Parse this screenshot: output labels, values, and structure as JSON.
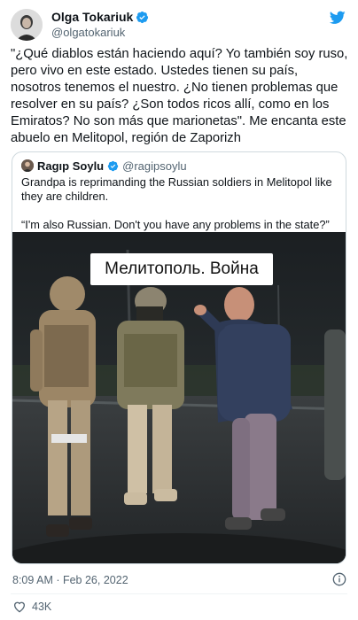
{
  "author": {
    "display_name": "Olga Tokariuk",
    "handle": "@olgatokariuk"
  },
  "tweet_text": "\"¿Qué diablos están haciendo aquí? Yo también soy ruso, pero vivo en este estado. Ustedes tienen su país, nosotros tenemos el nuestro. ¿No tienen problemas que resolver en su país? ¿Son todos ricos allí, como en los Emiratos? No son más que marionetas\". Me encanta este abuelo en Melitopol, región de Zaporizh",
  "quoted_tweet": {
    "display_name": "Ragıp Soylu",
    "handle": "@ragipsoylu",
    "text_paragraph_1": "Grandpa is reprimanding the Russian soldiers in Melitopol like they are children.",
    "text_paragraph_2": "“I'm also Russian. Don't you have any problems in the state?”",
    "video_caption": "Мелитополь. Война"
  },
  "timestamp": "8:09 AM · Feb 26, 2022",
  "like_count": "43K",
  "colors": {
    "twitter_blue": "#1d9bf0",
    "text_secondary": "#536471",
    "border": "#cfd9de"
  },
  "icons": {
    "brand": "twitter-bird-icon",
    "verified": "verified-badge-icon",
    "info": "info-icon",
    "like": "heart-icon"
  }
}
